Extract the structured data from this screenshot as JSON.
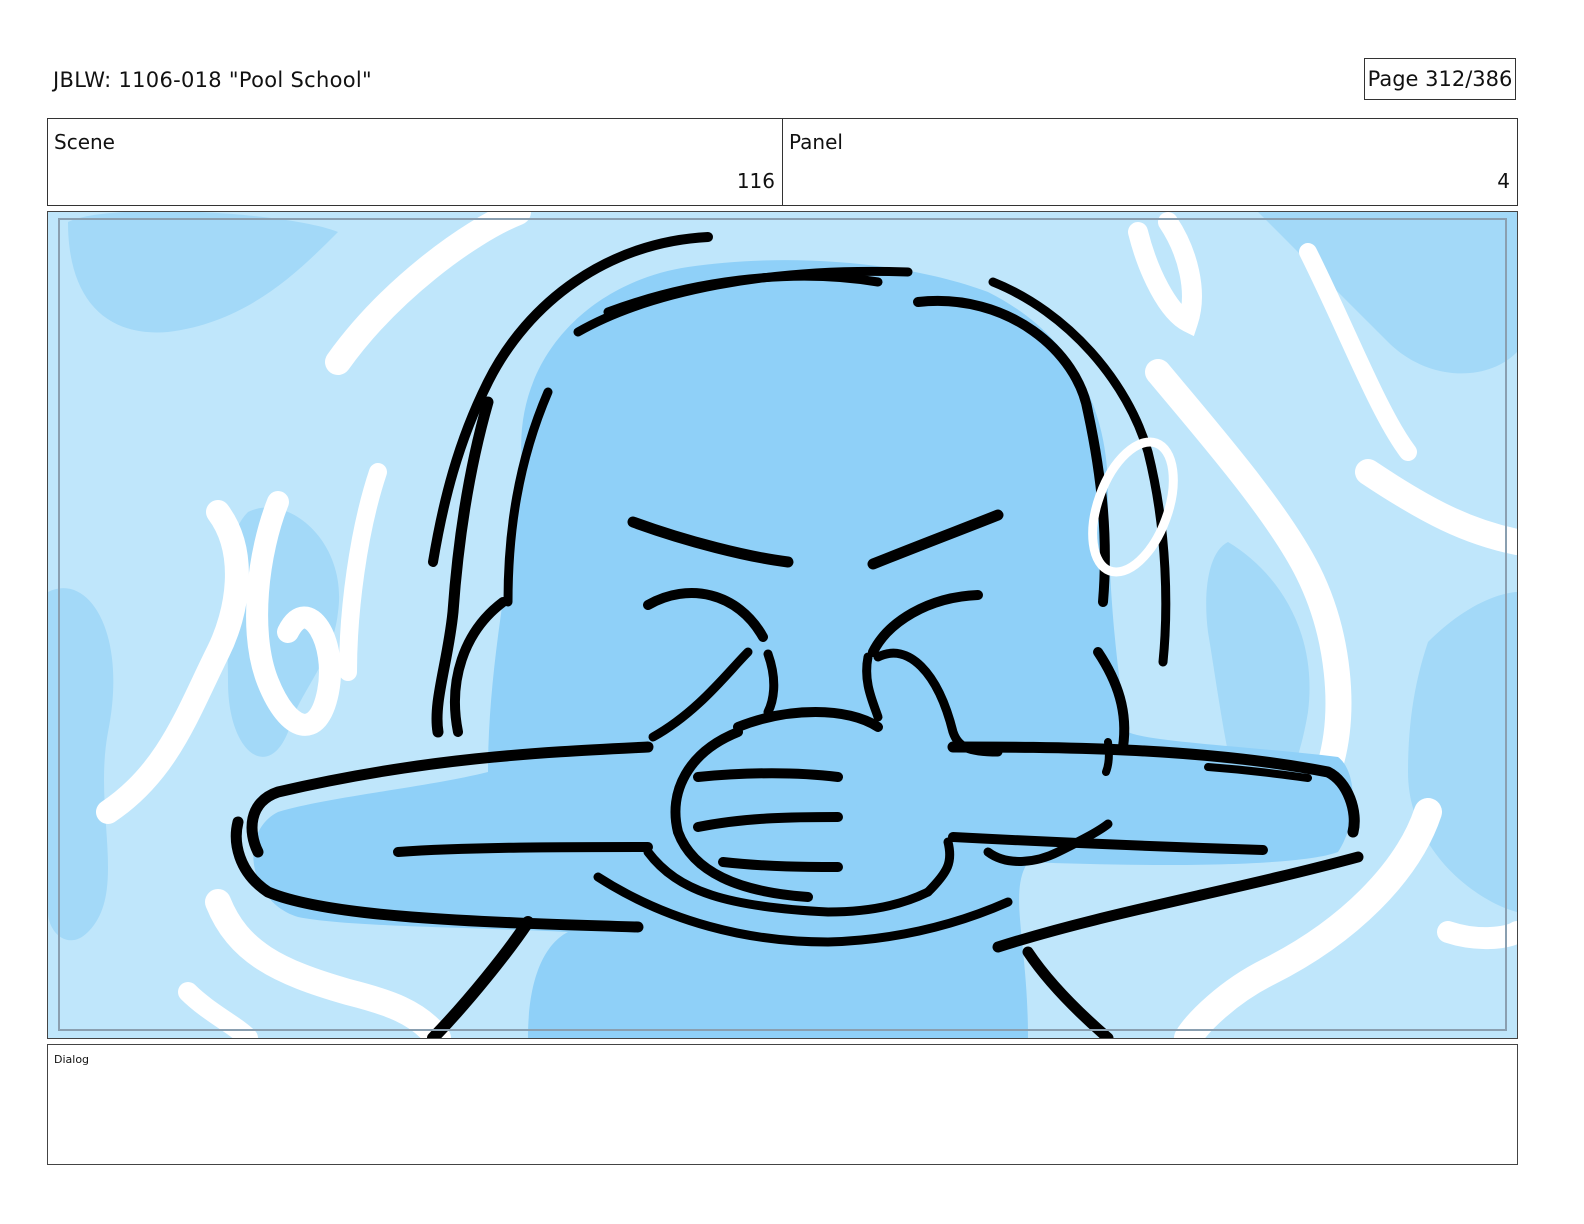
{
  "header": {
    "title": "JBLW: 1106-018 \"Pool School\"",
    "page": "Page 312/386"
  },
  "info": {
    "scene_label": "Scene",
    "scene_value": "116",
    "panel_label": "Panel",
    "panel_value": "4"
  },
  "panel_image": {
    "description_icon": "storyboard-drawing",
    "colors": {
      "water_light": "#bfe6fb",
      "water_mid": "#a3d9f8",
      "character": "#8fd0f8",
      "ink": "#000000"
    }
  },
  "dialog": {
    "label": "Dialog"
  }
}
